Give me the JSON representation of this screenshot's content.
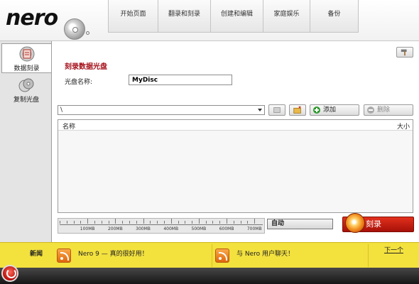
{
  "app": {
    "logo": "nero"
  },
  "tabs": [
    {
      "label": "开始页面"
    },
    {
      "label": "翻录和刻录"
    },
    {
      "label": "创建和编辑"
    },
    {
      "label": "家庭娱乐"
    },
    {
      "label": "备份"
    }
  ],
  "sidebar": {
    "items": [
      {
        "label": "数据刻录",
        "icon": "data-disc-icon",
        "active": true
      },
      {
        "label": "复制光盘",
        "icon": "copy-disc-icon",
        "active": false
      }
    ]
  },
  "main": {
    "title": "刻录数据光盘",
    "disc_name_label": "光盘名称:",
    "disc_name_value": "MyDisc",
    "path_value": "\\",
    "add_label": "添加",
    "delete_label": "删除",
    "columns": {
      "name": "名称",
      "size": "大小"
    },
    "capacity_ticks": [
      "100MB",
      "200MB",
      "300MB",
      "400MB",
      "500MB",
      "600MB",
      "700MB"
    ],
    "speed_value": "自动",
    "burn_label": "刻录"
  },
  "news": {
    "label": "新闻",
    "items": [
      {
        "text": "Nero 9 — 真的很好用！",
        "icon": "rss-icon"
      },
      {
        "text": "与 Nero 用户聊天！",
        "icon": "rss-icon"
      }
    ],
    "next_label": "下一个"
  },
  "colors": {
    "accent": "#a5101a",
    "news_bar": "#f3e13e",
    "burn_button": "#c8200f"
  }
}
